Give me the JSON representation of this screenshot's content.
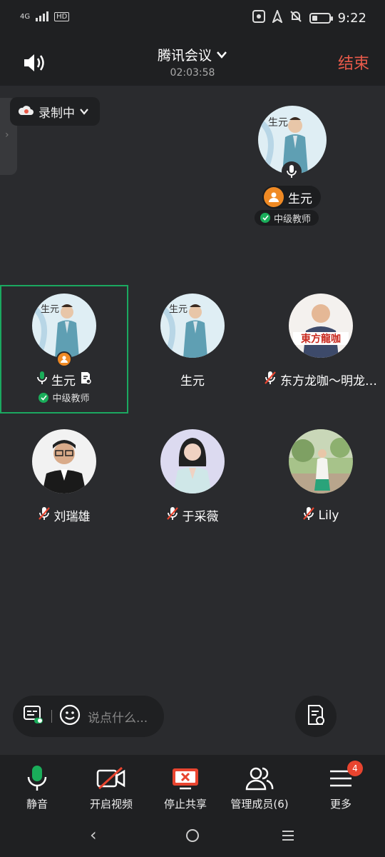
{
  "status_bar": {
    "network": "4G",
    "network2": "HD",
    "time": "9:22",
    "battery_level": 0.3
  },
  "header": {
    "title": "腾讯会议",
    "timer": "02:03:58",
    "end_label": "结束"
  },
  "recording": {
    "label": "录制中"
  },
  "featured": {
    "name": "生元",
    "tag": "中级教师"
  },
  "tiles": [
    {
      "name": "生元",
      "tag": "中级教师",
      "mic": "on",
      "avatar_style": "man-teal"
    },
    {
      "name": "生元",
      "tag": "",
      "mic": "none",
      "avatar_style": "man-teal"
    },
    {
      "name": "东方龙咖～明龙…",
      "tag": "",
      "mic": "muted",
      "avatar_style": "man-red"
    },
    {
      "name": "刘瑞雄",
      "tag": "",
      "mic": "muted",
      "avatar_style": "man-glasses"
    },
    {
      "name": "于采薇",
      "tag": "",
      "mic": "muted",
      "avatar_style": "woman-lavender"
    },
    {
      "name": "Lily",
      "tag": "",
      "mic": "muted",
      "avatar_style": "woman-garden"
    }
  ],
  "chat": {
    "placeholder": "说点什么..."
  },
  "toolbar": {
    "mute": "静音",
    "video": "开启视频",
    "share": "停止共享",
    "members": "管理成员(6)",
    "more": "更多",
    "more_badge": "4"
  },
  "colors": {
    "accent_green": "#1ba860",
    "end_red": "#e85a4a",
    "host_orange": "#f08a24",
    "background": "#2a2b2e"
  }
}
